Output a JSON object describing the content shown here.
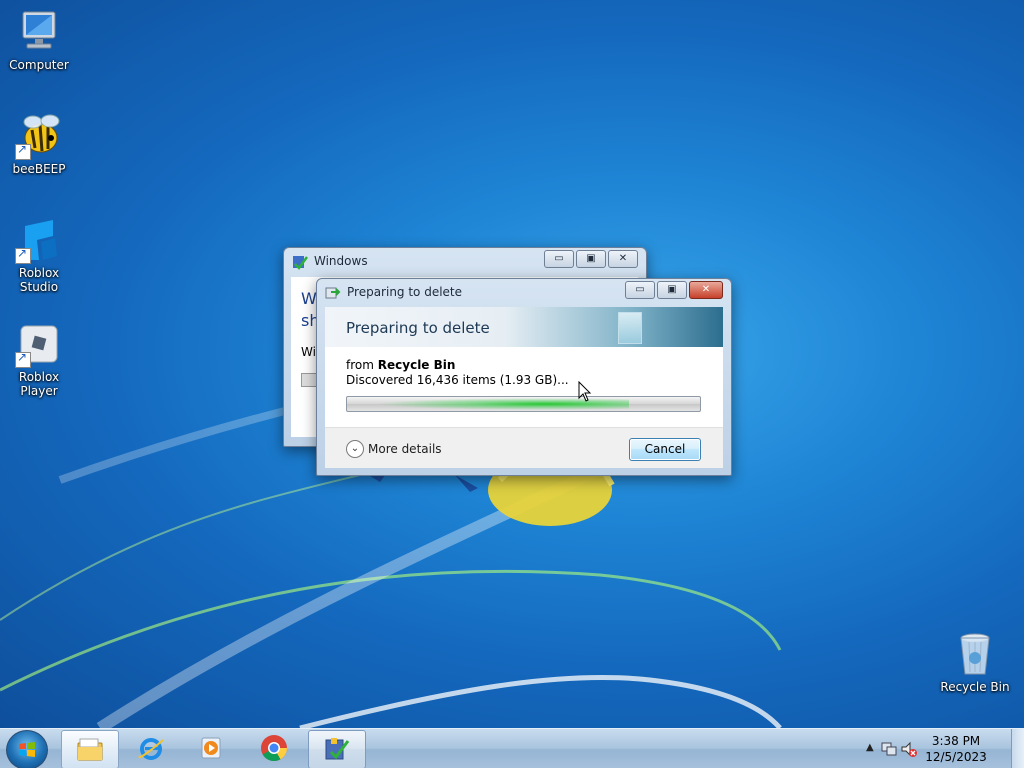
{
  "desktop": {
    "icons": [
      {
        "label": "Computer"
      },
      {
        "label": "beeBEEP"
      },
      {
        "label": "Roblox Studio"
      },
      {
        "label": "Roblox Player"
      },
      {
        "label": "Recycle Bin"
      }
    ]
  },
  "back_window": {
    "title": "Windows",
    "text_line1": "W",
    "text_line2": "sh",
    "text_line3": "Wi"
  },
  "dialog": {
    "title": "Preparing to delete",
    "heading": "Preparing to delete",
    "from_prefix": "from",
    "from_location": "Recycle Bin",
    "discovered": "Discovered 16,436 items (1.93 GB)...",
    "progress_fraction": 0.8,
    "more_details": "More details",
    "cancel": "Cancel"
  },
  "taskbar": {
    "pinned": [
      {
        "icon": "file-explorer-icon",
        "state": "active"
      },
      {
        "icon": "internet-explorer-icon",
        "state": "idle"
      },
      {
        "icon": "media-player-icon",
        "state": "idle"
      },
      {
        "icon": "chrome-icon",
        "state": "idle"
      },
      {
        "icon": "file-operation-icon",
        "state": "running"
      }
    ],
    "clock": {
      "time": "3:38 PM",
      "date": "12/5/2023"
    }
  },
  "colors": {
    "desktop_blue": "#1f86d6",
    "progress_green": "#1ec828",
    "close_red": "#c7412a"
  }
}
